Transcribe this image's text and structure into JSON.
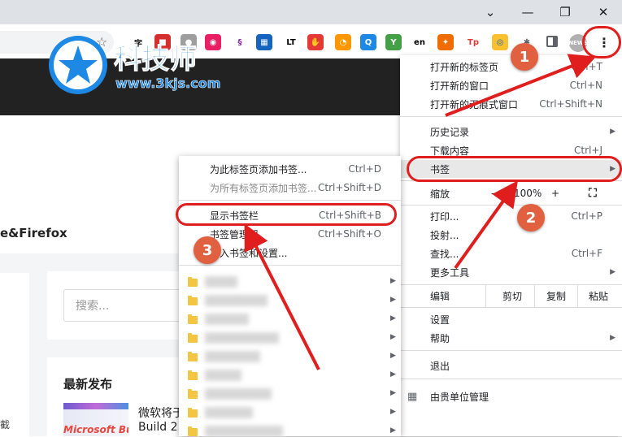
{
  "window": {
    "controls": [
      "minimize",
      "restore",
      "close"
    ]
  },
  "page": {
    "browser_title": "e&Firefox",
    "search_placeholder": "搜索...",
    "latest_title": "最新发布",
    "article_line1": "微软将于",
    "article_line2": "Build 2",
    "thumb_text": "Microsoft Build",
    "edge_char": "截"
  },
  "watermark": {
    "brand": "科技师",
    "url": "www.3kjs.com"
  },
  "chrome_menu": {
    "new_tab": "打开新的标签页",
    "new_tab_shortcut": "Ctrl+T",
    "new_window": "打开新的窗口",
    "new_window_shortcut": "Ctrl+N",
    "incognito": "打开新的无痕式窗口",
    "incognito_shortcut": "Ctrl+Shift+N",
    "history": "历史记录",
    "downloads": "下载内容",
    "downloads_shortcut": "Ctrl+J",
    "bookmarks": "书签",
    "zoom": "缩放",
    "zoom_minus": "-",
    "zoom_value": "100%",
    "zoom_plus": "+",
    "print": "打印...",
    "print_shortcut": "Ctrl+P",
    "cast": "投射...",
    "find": "查找...",
    "find_shortcut": "Ctrl+F",
    "more_tools": "更多工具",
    "edit": "编辑",
    "cut": "剪切",
    "copy": "复制",
    "paste": "粘贴",
    "settings": "设置",
    "help": "帮助",
    "exit": "退出",
    "managed": "由贵单位管理"
  },
  "bookmarks_menu": {
    "bookmark_tab": "为此标签页添加书签...",
    "bookmark_tab_shortcut": "Ctrl+D",
    "bookmark_all": "为所有标签页添加书签...",
    "bookmark_all_shortcut": "Ctrl+Shift+D",
    "show_bar": "显示书签栏",
    "show_bar_shortcut": "Ctrl+Shift+B",
    "manager": "书签管理器",
    "manager_shortcut": "Ctrl+Shift+O",
    "import": "导入书签和设置..."
  },
  "annotations": {
    "step1": "1",
    "step2": "2",
    "step3": "3"
  },
  "extensions": [
    {
      "label": "字",
      "color": "#ffffff",
      "fg": "#000"
    },
    {
      "label": "■",
      "color": "#d32f2f",
      "fg": "#fff"
    },
    {
      "label": "●",
      "color": "#9e9e9e",
      "fg": "#fff"
    },
    {
      "label": "◉",
      "color": "#e91e63",
      "fg": "#fff"
    },
    {
      "label": "§",
      "color": "#ffffff",
      "fg": "#8e24aa"
    },
    {
      "label": "▦",
      "color": "#1565c0",
      "fg": "#fff"
    },
    {
      "label": "LT",
      "color": "#ffffff",
      "fg": "#000"
    },
    {
      "label": "✋",
      "color": "#e53935",
      "fg": "#fff"
    },
    {
      "label": "◔",
      "color": "#ff9800",
      "fg": "#fff"
    },
    {
      "label": "Q",
      "color": "#1e88e5",
      "fg": "#fff"
    },
    {
      "label": "Y",
      "color": "#43a047",
      "fg": "#fff"
    },
    {
      "label": "en",
      "color": "#ffffff",
      "fg": "#000"
    },
    {
      "label": "✦",
      "color": "#ef6c00",
      "fg": "#fff"
    },
    {
      "label": "Tp",
      "color": "#ffffff",
      "fg": "#e53935"
    },
    {
      "label": "◎",
      "color": "#fbc02d",
      "fg": "#1565c0"
    },
    {
      "label": "✱",
      "color": "#ffffff",
      "fg": "#5f6368"
    }
  ]
}
